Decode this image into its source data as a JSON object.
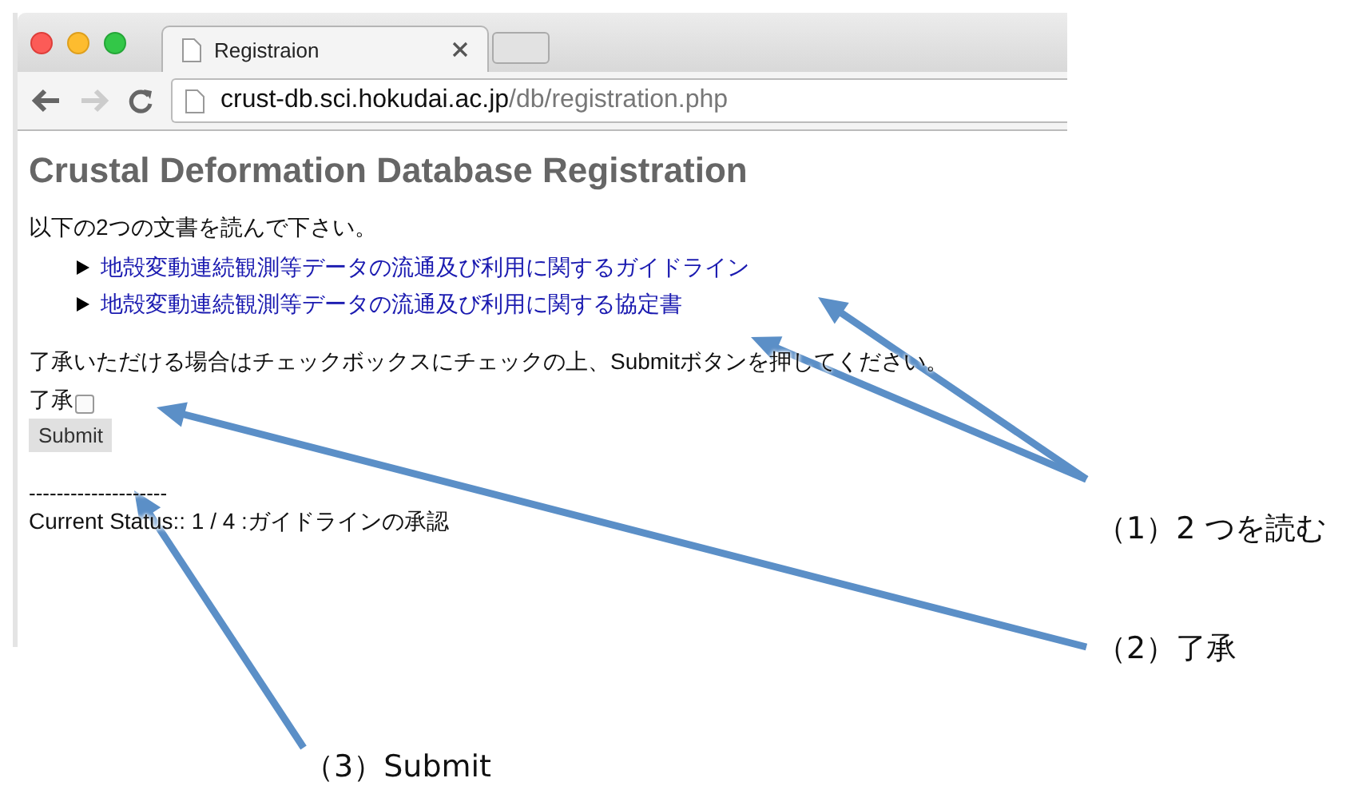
{
  "browser": {
    "tab": {
      "title": "Registraion"
    },
    "url": {
      "host": "crust-db.sci.hokudai.ac.jp",
      "path": "/db/registration.php"
    }
  },
  "page": {
    "heading": "Crustal Deformation Database Registration",
    "intro": "以下の2つの文書を読んで下さい。",
    "links": [
      "地殻変動連続観測等データの流通及び利用に関するガイドライン",
      "地殻変動連続観測等データの流通及び利用に関する協定書"
    ],
    "instruction": "了承いただける場合はチェックボックスにチェックの上、Submitボタンを押してください。",
    "checkbox": {
      "label": "了承",
      "checked": false
    },
    "submit": "Submit",
    "divider": "--------------------",
    "status": "Current Status:: 1 / 4 :ガイドラインの承認"
  },
  "callouts": [
    {
      "label": "（1）2 つを読む"
    },
    {
      "label": "（2）了承"
    },
    {
      "label": "（3）Submit"
    }
  ]
}
